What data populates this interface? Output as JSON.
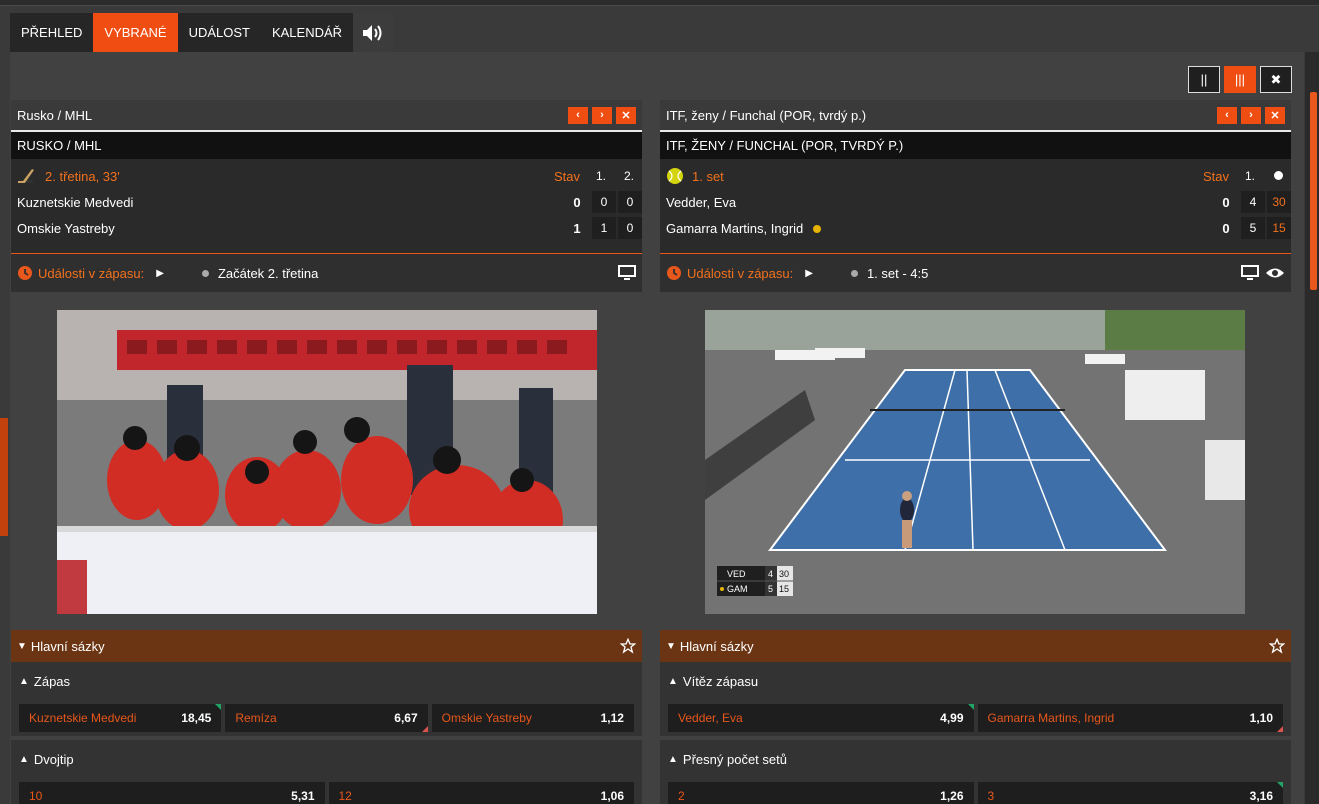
{
  "nav": {
    "tabs": [
      {
        "label": "PŘEHLED",
        "active": false
      },
      {
        "label": "VYBRANÉ",
        "active": true
      },
      {
        "label": "UDÁLOST",
        "active": false
      },
      {
        "label": "KALENDÁŘ",
        "active": false
      }
    ],
    "sound_icon": "speaker-icon"
  },
  "layout_buttons": [
    {
      "label": "||",
      "active": false
    },
    {
      "label": "|||",
      "active": true
    },
    {
      "label": "✖",
      "active": false
    }
  ],
  "colors": {
    "accent": "#f04d12",
    "market_header": "#6b3514",
    "odd_up": "#21a366",
    "odd_down": "#d9534f"
  },
  "left": {
    "title": "Rusko / MHL",
    "subtitle": "RUSKO / MHL",
    "status": "2. třetina, 33'",
    "sport_icon": "hockey-stick-icon",
    "score_header": {
      "stav": "Stav",
      "p1": "1.",
      "p2": "2."
    },
    "teams": [
      {
        "name": "Kuznetskie Medvedi",
        "total": "0",
        "p1": "0",
        "p2": "0"
      },
      {
        "name": "Omskie Yastreby",
        "total": "1",
        "p1": "1",
        "p2": "0"
      }
    ],
    "events_label": "Události v zápasu:",
    "event_text": "Začátek 2. třetina",
    "markets": {
      "title": "Hlavní sázky",
      "sections": [
        {
          "title": "Zápas",
          "odds": [
            {
              "name": "Kuznetskie Medvedi",
              "value": "18,45",
              "trend": "up"
            },
            {
              "name": "Remíza",
              "value": "6,67",
              "trend": "down"
            },
            {
              "name": "Omskie Yastreby",
              "value": "1,12",
              "trend": ""
            }
          ]
        },
        {
          "title": "Dvojtip",
          "odds": [
            {
              "name": "10",
              "value": "5,31",
              "trend": ""
            },
            {
              "name": "12",
              "value": "1,06",
              "trend": ""
            }
          ]
        }
      ]
    }
  },
  "right": {
    "title": "ITF, ženy / Funchal (POR, tvrdý p.)",
    "subtitle": "ITF, ŽENY / FUNCHAL (POR, TVRDÝ P.)",
    "status": "1. set",
    "sport_icon": "tennis-ball-icon",
    "score_header": {
      "stav": "Stav",
      "p1": "1."
    },
    "teams": [
      {
        "name": "Vedder, Eva",
        "total": "0",
        "p1": "4",
        "p2": "30",
        "serving": false
      },
      {
        "name": "Gamarra Martins, Ingrid",
        "total": "0",
        "p1": "5",
        "p2": "15",
        "serving": true
      }
    ],
    "events_label": "Události v zápasu:",
    "event_text": "1. set - 4:5",
    "video_overlay": [
      {
        "abbr": "VED",
        "g": "4",
        "p": "30"
      },
      {
        "abbr": "GAM",
        "g": "5",
        "p": "15"
      }
    ],
    "markets": {
      "title": "Hlavní sázky",
      "sections": [
        {
          "title": "Vítěz zápasu",
          "odds": [
            {
              "name": "Vedder, Eva",
              "value": "4,99",
              "trend": "up"
            },
            {
              "name": "Gamarra Martins, Ingrid",
              "value": "1,10",
              "trend": "down"
            }
          ]
        },
        {
          "title": "Přesný počet setů",
          "odds": [
            {
              "name": "2",
              "value": "1,26",
              "trend": ""
            },
            {
              "name": "3",
              "value": "3,16",
              "trend": "up"
            }
          ]
        }
      ]
    }
  }
}
